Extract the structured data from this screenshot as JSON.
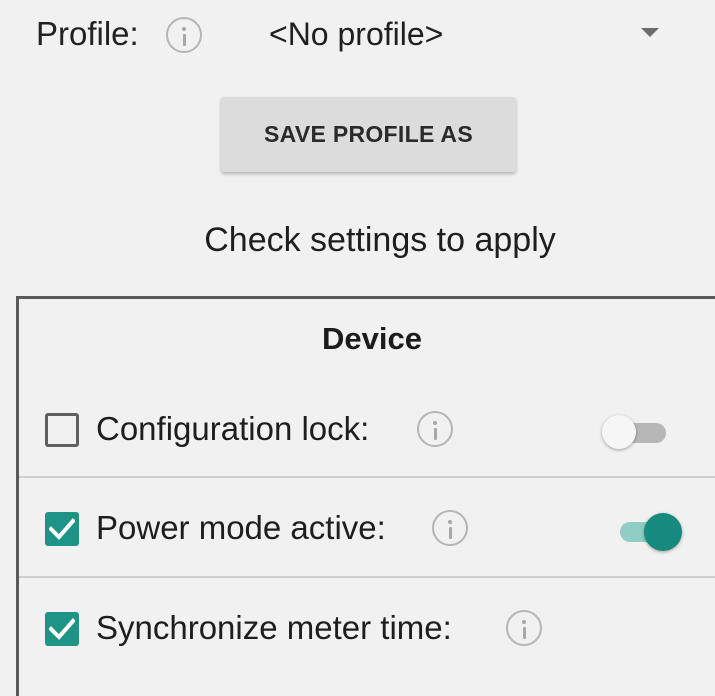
{
  "profile": {
    "label": "Profile:",
    "selected_value": "<No profile>"
  },
  "save_button_label": "SAVE PROFILE AS",
  "caption": "Check settings to apply",
  "device": {
    "title": "Device",
    "settings": [
      {
        "label": "Configuration lock:",
        "checked": false,
        "switch_on": false
      },
      {
        "label": "Power mode active:",
        "checked": true,
        "switch_on": true
      },
      {
        "label": "Synchronize meter time:",
        "checked": true,
        "switch_on": null
      }
    ]
  },
  "colors": {
    "background": "#f0f1f0",
    "accent": "#1e9487",
    "switch_on_track": "#8fcdc5",
    "switch_off_track": "#b7b7b7",
    "button_bg": "#dcdcdc"
  },
  "icons": {
    "info": "info-icon",
    "dropdown": "dropdown-arrow-icon",
    "check": "checkmark-icon"
  }
}
